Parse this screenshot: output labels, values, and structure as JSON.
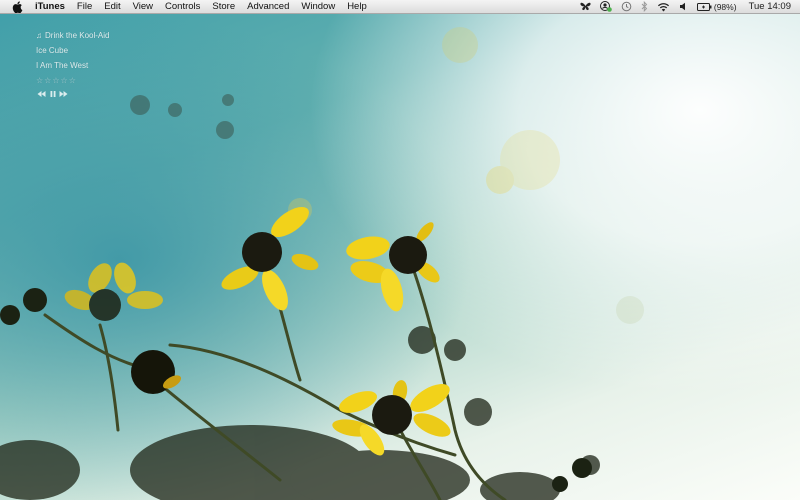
{
  "menubar": {
    "app_name": "iTunes",
    "menus": [
      "File",
      "Edit",
      "View",
      "Controls",
      "Store",
      "Advanced",
      "Window",
      "Help"
    ],
    "status_icons": [
      "butterfly-icon",
      "user-icon",
      "time-machine-icon",
      "bluetooth-icon",
      "wifi-icon",
      "volume-icon",
      "battery-icon"
    ],
    "battery_percent": "(98%)",
    "clock": "Tue 14:09"
  },
  "now_playing": {
    "track": "Drink the Kool-Aid",
    "artist": "Ice Cube",
    "album": "I Am The West",
    "rating_stars": "☆☆☆☆☆",
    "controls": [
      "previous-icon",
      "pause-icon",
      "next-icon"
    ]
  },
  "colors": {
    "menubar": "#e6e6e6",
    "sky_teal": "#3f9ea9",
    "sky_light": "#fbfdf9",
    "petal_yellow": "#f2d21a",
    "flower_center": "#1b1a10",
    "stem": "#3f4a26"
  }
}
